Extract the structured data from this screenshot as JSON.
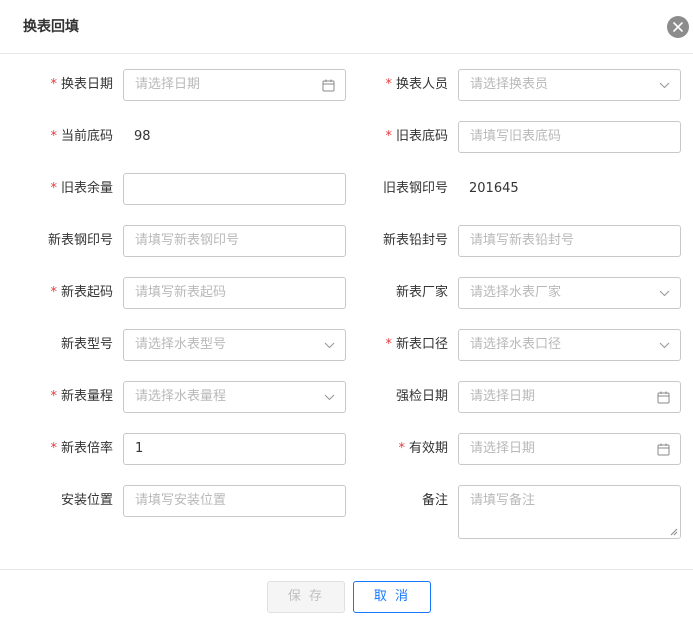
{
  "dialog": {
    "title": "换表回填",
    "close_icon": "close-icon"
  },
  "fields": {
    "replace_date": {
      "label": "换表日期",
      "required": "*",
      "placeholder": "请选择日期",
      "icon": "calendar-icon"
    },
    "replace_person": {
      "label": "换表人员",
      "required": "*",
      "placeholder": "请选择换表员",
      "icon": "chevron-down-icon"
    },
    "current_reading": {
      "label": "当前底码",
      "required": "*",
      "value": "98"
    },
    "old_meter_reading": {
      "label": "旧表底码",
      "required": "*",
      "placeholder": "请填写旧表底码"
    },
    "old_meter_balance": {
      "label": "旧表余量",
      "required": "*",
      "value": ""
    },
    "old_meter_seal": {
      "label": "旧表钢印号",
      "value": "201645"
    },
    "new_meter_seal": {
      "label": "新表钢印号",
      "placeholder": "请填写新表钢印号"
    },
    "new_meter_lead_seal": {
      "label": "新表铅封号",
      "placeholder": "请填写新表铅封号"
    },
    "new_meter_start": {
      "label": "新表起码",
      "required": "*",
      "placeholder": "请填写新表起码"
    },
    "new_meter_manufacturer": {
      "label": "新表厂家",
      "placeholder": "请选择水表厂家",
      "icon": "chevron-down-icon"
    },
    "new_meter_model": {
      "label": "新表型号",
      "placeholder": "请选择水表型号",
      "icon": "chevron-down-icon"
    },
    "new_meter_caliber": {
      "label": "新表口径",
      "required": "*",
      "placeholder": "请选择水表口径",
      "icon": "chevron-down-icon"
    },
    "new_meter_range": {
      "label": "新表量程",
      "required": "*",
      "placeholder": "请选择水表量程",
      "icon": "chevron-down-icon"
    },
    "inspection_date": {
      "label": "强检日期",
      "placeholder": "请选择日期",
      "icon": "calendar-icon"
    },
    "new_meter_ratio": {
      "label": "新表倍率",
      "required": "*",
      "value": "1"
    },
    "valid_period": {
      "label": "有效期",
      "required": "*",
      "placeholder": "请选择日期",
      "icon": "calendar-icon"
    },
    "install_location": {
      "label": "安装位置",
      "placeholder": "请填写安装位置"
    },
    "remarks": {
      "label": "备注",
      "placeholder": "请填写备注"
    }
  },
  "footer": {
    "save_label": "保 存",
    "cancel_label": "取 消"
  },
  "colors": {
    "required": "#e4393c",
    "primary": "#1677ff",
    "placeholder": "#b9b9b9",
    "border": "#c8c8c8"
  }
}
